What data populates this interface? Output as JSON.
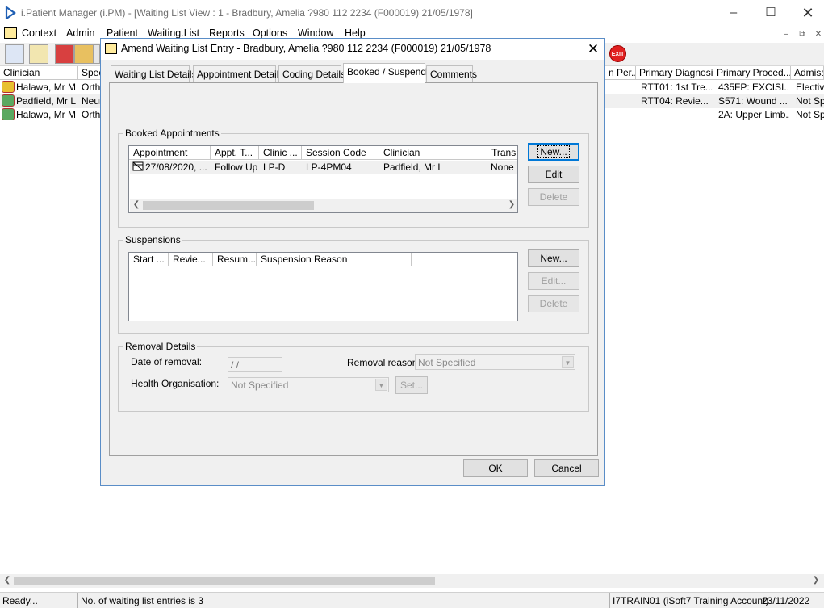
{
  "app": {
    "title": "i.Patient Manager (i.PM) - [Waiting List View :  1 - Bradbury, Amelia ?980 112 2234 (F000019) 21/05/1978]"
  },
  "menu": [
    "Context",
    "Admin",
    "Patient",
    "Waiting.List",
    "Reports",
    "Options",
    "Window",
    "Help"
  ],
  "toolbar": {
    "exit_label": "EXIT"
  },
  "background_list": {
    "columns": [
      "Clinician",
      "Spec",
      "n Per...",
      "Primary Diagnosis",
      "Primary Proced...",
      "Admissi"
    ],
    "rows": [
      {
        "clinician": "Halawa, Mr M",
        "spec": "Ortho",
        "diagnosis": "RTT01: 1st Tre...",
        "procedure": "435FP: EXCISI...",
        "admission": "Elective"
      },
      {
        "clinician": "Padfield, Mr L",
        "spec": "Neur",
        "diagnosis": "RTT04: Revie...",
        "procedure": "S571: Wound ...",
        "admission": "Not Spe"
      },
      {
        "clinician": "Halawa, Mr M",
        "spec": "Ortho",
        "diagnosis": "",
        "procedure": "2A: Upper Limb...",
        "admission": "Not Spe"
      }
    ]
  },
  "dialog": {
    "title": "Amend Waiting List Entry - Bradbury, Amelia ?980 112 2234 (F000019) 21/05/1978",
    "tabs": [
      "Waiting List Details",
      "Appointment Details",
      "Coding Details",
      "Booked / Suspend",
      "Comments"
    ],
    "active_tab": "Booked / Suspend",
    "booked": {
      "legend": "Booked Appointments",
      "columns": [
        "Appointment",
        "Appt. T...",
        "Clinic ...",
        "Session Code",
        "Clinician",
        "Transp"
      ],
      "rows": [
        {
          "appointment": "27/08/2020, ...",
          "type": "Follow Up",
          "clinic": "LP-D",
          "session": "LP-4PM04",
          "clinician": "Padfield, Mr L",
          "transport": "None"
        }
      ],
      "buttons": {
        "new": "New...",
        "edit": "Edit",
        "delete": "Delete"
      }
    },
    "suspensions": {
      "legend": "Suspensions",
      "columns": [
        "Start ...",
        "Revie...",
        "Resum...",
        "Suspension Reason",
        ""
      ],
      "buttons": {
        "new": "New...",
        "edit": "Edit...",
        "delete": "Delete"
      }
    },
    "removal": {
      "legend": "Removal Details",
      "date_label": "Date of removal:",
      "date_value": " /  /",
      "reason_label": "Removal reason:",
      "reason_value": "Not Specified",
      "org_label": "Health Organisation:",
      "org_value": "Not Specified",
      "set_button": "Set..."
    },
    "ok": "OK",
    "cancel": "Cancel"
  },
  "status": {
    "ready": "Ready...",
    "message": "No. of waiting list entries is 3",
    "account": "I7TRAIN01 (iSoft7 Training Account)",
    "date": "23/11/2022"
  }
}
